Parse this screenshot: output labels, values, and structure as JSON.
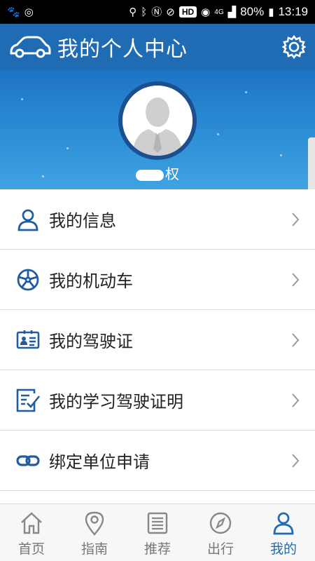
{
  "status_bar": {
    "hd_badge": "HD",
    "network": "4G",
    "battery": "80%",
    "time": "13:19",
    "icons": [
      "baidu-icon",
      "sync-icon",
      "location-icon",
      "bluetooth-icon",
      "nfc-icon",
      "mute-icon",
      "hotspot-icon",
      "signal-icon",
      "battery-icon"
    ]
  },
  "header": {
    "title": "我的个人中心",
    "logo_icon": "car-icon",
    "settings_icon": "gear-icon"
  },
  "profile": {
    "name_visible": "权",
    "avatar_icon": "user-avatar-icon"
  },
  "menu": {
    "items": [
      {
        "label": "我的信息",
        "icon": "person-icon"
      },
      {
        "label": "我的机动车",
        "icon": "wheel-icon"
      },
      {
        "label": "我的驾驶证",
        "icon": "license-card-icon"
      },
      {
        "label": "我的学习驾驶证明",
        "icon": "checklist-icon"
      },
      {
        "label": "绑定单位申请",
        "icon": "link-icon"
      }
    ]
  },
  "bottom_nav": {
    "items": [
      {
        "label": "首页",
        "icon": "home-icon",
        "active": false
      },
      {
        "label": "指南",
        "icon": "map-pin-icon",
        "active": false
      },
      {
        "label": "推荐",
        "icon": "document-icon",
        "active": false
      },
      {
        "label": "出行",
        "icon": "compass-icon",
        "active": false
      },
      {
        "label": "我的",
        "icon": "user-icon",
        "active": true
      }
    ]
  },
  "colors": {
    "primary": "#1f6bb4",
    "banner_light": "#3fa3e2",
    "menu_icon": "#1f5d9e",
    "inactive_nav": "#777777"
  }
}
